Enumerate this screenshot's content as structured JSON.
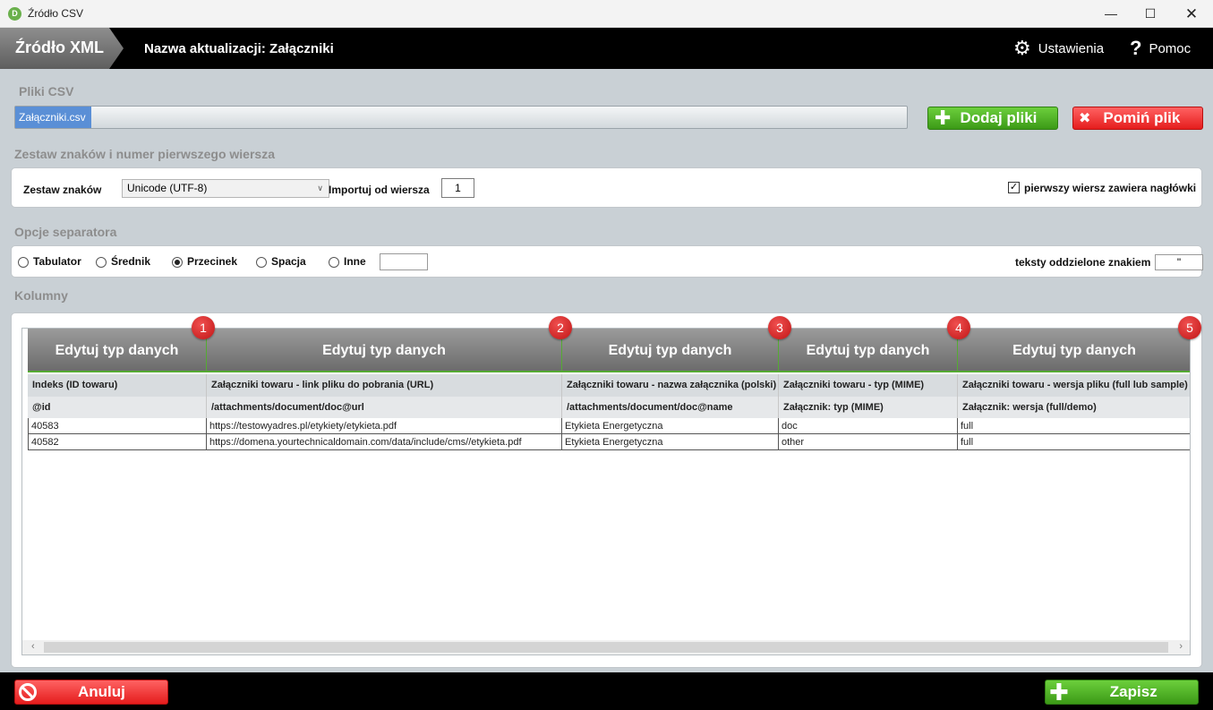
{
  "window": {
    "title": "Źródło CSV",
    "app_icon_text": "D"
  },
  "header": {
    "tab_label": "Źródło XML",
    "update_name": "Nazwa aktualizacji: Załączniki",
    "settings_label": "Ustawienia",
    "help_label": "Pomoc"
  },
  "csv_files": {
    "title": "Pliki CSV",
    "file_name": "Załączniki.csv",
    "add_label": "Dodaj pliki",
    "skip_label": "Pomiń plik"
  },
  "charset": {
    "title": "Zestaw znaków i numer pierwszego wiersza",
    "charset_label": "Zestaw znaków",
    "charset_value": "Unicode (UTF-8)",
    "import_from_label": "Importuj od wiersza",
    "import_from_value": "1",
    "header_row_label": "pierwszy wiersz zawiera nagłówki",
    "header_row_checked": true
  },
  "separator": {
    "title": "Opcje separatora",
    "options": [
      "Tabulator",
      "Średnik",
      "Przecinek",
      "Spacja",
      "Inne"
    ],
    "selected": "Przecinek",
    "other_value": "",
    "quote_label": "teksty oddzielone znakiem",
    "quote_value": "\""
  },
  "columns": {
    "title": "Kolumny",
    "header_button": "Edytuj typ danych",
    "badges": [
      "1",
      "2",
      "3",
      "4",
      "5"
    ],
    "names": [
      "Indeks (ID towaru)",
      "Załączniki towaru - link pliku do pobrania (URL)",
      "Załączniki towaru - nazwa załącznika (polski)",
      "Załączniki towaru - typ (MIME)",
      "Załączniki towaru - wersja pliku (full lub sample)"
    ],
    "paths": [
      "@id",
      "/attachments/document/doc@url",
      "/attachments/document/doc@name",
      "Załącznik: typ (MIME)",
      "Załącznik: wersja (full/demo)"
    ],
    "rows": [
      [
        "40583",
        "https://testowyadres.pl/etykiety/etykieta.pdf",
        "Etykieta Energetyczna",
        "doc",
        "full"
      ],
      [
        "40582",
        "https://domena.yourtechnicaldomain.com/data/include/cms//etykieta.pdf",
        "Etykieta Energetyczna",
        "other",
        "full"
      ]
    ]
  },
  "footer": {
    "cancel_label": "Anuluj",
    "save_label": "Zapisz"
  }
}
